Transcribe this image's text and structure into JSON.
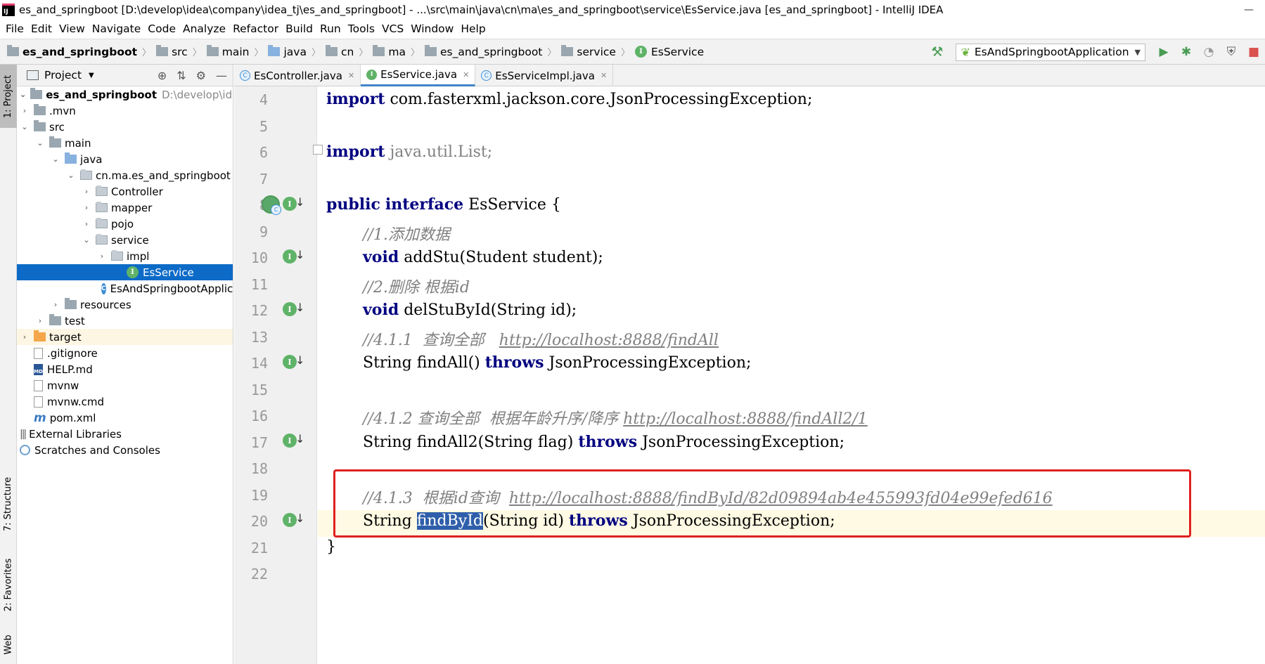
{
  "window": {
    "title": "es_and_springboot [D:\\develop\\idea\\company\\idea_tj\\es_and_springboot] - ...\\src\\main\\java\\cn\\ma\\es_and_springboot\\service\\EsService.java [es_and_springboot] - IntelliJ IDEA",
    "logo_text": "IJ",
    "minimize": "—"
  },
  "menu": [
    {
      "label": "File"
    },
    {
      "label": "Edit"
    },
    {
      "label": "View"
    },
    {
      "label": "Navigate"
    },
    {
      "label": "Code"
    },
    {
      "label": "Analyze"
    },
    {
      "label": "Refactor"
    },
    {
      "label": "Build"
    },
    {
      "label": "Run"
    },
    {
      "label": "Tools"
    },
    {
      "label": "VCS"
    },
    {
      "label": "Window"
    },
    {
      "label": "Help"
    }
  ],
  "breadcrumb": [
    "es_and_springboot",
    "src",
    "main",
    "java",
    "cn",
    "ma",
    "es_and_springboot",
    "service",
    "EsService"
  ],
  "run_config": {
    "label": "EsAndSpringbootApplication"
  },
  "left_stripe": {
    "project": "1: Project",
    "structure": "7: Structure",
    "favorites": "2: Favorites",
    "web": "Web"
  },
  "project_panel": {
    "title": "Project",
    "tree": [
      {
        "label": "es_and_springboot",
        "hint": "D:\\develop\\idea\\c"
      },
      {
        "label": ".mvn"
      },
      {
        "label": "src"
      },
      {
        "label": "main"
      },
      {
        "label": "java"
      },
      {
        "label": "cn.ma.es_and_springboot"
      },
      {
        "label": "Controller"
      },
      {
        "label": "mapper"
      },
      {
        "label": "pojo"
      },
      {
        "label": "service"
      },
      {
        "label": "impl"
      },
      {
        "label": "EsService"
      },
      {
        "label": "EsAndSpringbootApplication"
      },
      {
        "label": "resources"
      },
      {
        "label": "test"
      },
      {
        "label": "target"
      },
      {
        "label": ".gitignore"
      },
      {
        "label": "HELP.md"
      },
      {
        "label": "mvnw"
      },
      {
        "label": "mvnw.cmd"
      },
      {
        "label": "pom.xml"
      },
      {
        "label": "External Libraries"
      },
      {
        "label": "Scratches and Consoles"
      }
    ]
  },
  "tabs": [
    {
      "label": "EsController.java"
    },
    {
      "label": "EsService.java"
    },
    {
      "label": "EsServiceImpl.java"
    }
  ],
  "editor": {
    "line_numbers": [
      "4",
      "5",
      "6",
      "7",
      "8",
      "9",
      "10",
      "11",
      "12",
      "13",
      "14",
      "15",
      "16",
      "17",
      "18",
      "19",
      "20",
      "21",
      "22"
    ],
    "code": {
      "l4_kw": "import",
      "l4_rest": " com.fasterxml.jackson.core.JsonProcessingException;",
      "l6_kw": "import",
      "l6_rest": " java.util.List;",
      "l8_kw1": "public",
      "l8_kw2": "interface",
      "l8_rest": " EsService {",
      "l9_comment": "//1.添加数据",
      "l10_kw": "void",
      "l10_rest": " addStu(Student student);",
      "l11_comment": "//2.删除 根据id",
      "l12_kw": "void",
      "l12_rest": " delStuById(String id);",
      "l13_comment": "//4.1.1  查询全部   ",
      "l13_url": "http://localhost:8888/findAll",
      "l14_pre": "String findAll() ",
      "l14_kw": "throws",
      "l14_rest": " JsonProcessingException;",
      "l16_comment": "//4.1.2 查询全部  根据年龄升序/降序 ",
      "l16_url": "http://localhost:8888/findAll2/1",
      "l17_pre": "String findAll2(String flag) ",
      "l17_kw": "throws",
      "l17_rest": " JsonProcessingException;",
      "l19_comment": "//4.1.3  根据id查询  ",
      "l19_url": "http://localhost:8888/findById/82d09894ab4e455993fd04e99efed616",
      "l20_pre": "String ",
      "l20_sel": "findById",
      "l20_mid": "(String id) ",
      "l20_kw": "throws",
      "l20_rest": " JsonProcessingException;",
      "l21": "}"
    }
  },
  "colors": {
    "keyword": "#000080",
    "comment": "#808080",
    "selection": "#2f5faa",
    "current_line": "#fffae3",
    "highlight_box": "#e02020",
    "tree_selection": "#0d6bc7"
  }
}
